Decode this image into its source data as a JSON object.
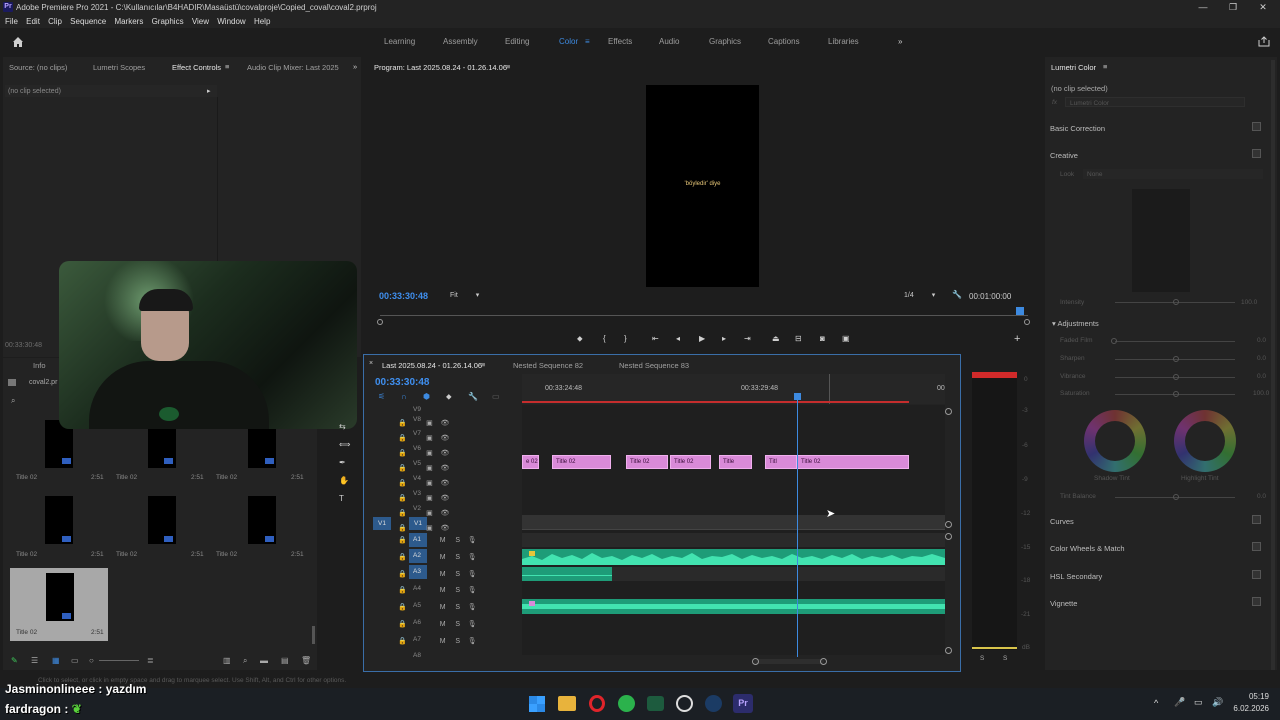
{
  "window": {
    "title": "Adobe Premiere Pro 2021 - C:\\Kullanıcılar\\B4HADIR\\Masaüstü\\covalproje\\Copied_coval\\coval2.prproj",
    "logo": "Pr"
  },
  "menu": [
    "File",
    "Edit",
    "Clip",
    "Sequence",
    "Markers",
    "Graphics",
    "View",
    "Window",
    "Help"
  ],
  "workspaces": [
    "Learning",
    "Assembly",
    "Editing",
    "Color",
    "Effects",
    "Audio",
    "Graphics",
    "Captions",
    "Libraries"
  ],
  "workspace_active": "Color",
  "source_panel": {
    "tabs": [
      "Source: (no clips)",
      "Lumetri Scopes",
      "Effect Controls",
      "Audio Clip Mixer: Last 2025"
    ],
    "active_tab": "Effect Controls",
    "no_clip": "(no clip selected)",
    "timecode": "00:33:30:48"
  },
  "project_panel": {
    "tabs": [
      "Info"
    ],
    "file": "coval2.pr",
    "items": [
      {
        "name": "Title 02",
        "dur": "2:51"
      },
      {
        "name": "Title 02",
        "dur": "2:51"
      },
      {
        "name": "Title 02",
        "dur": "2:51"
      },
      {
        "name": "Title 02",
        "dur": "2:51"
      },
      {
        "name": "Title 02",
        "dur": "2:51"
      },
      {
        "name": "Title 02",
        "dur": "2:51"
      },
      {
        "name": "Title 02",
        "dur": "2:51"
      }
    ]
  },
  "program": {
    "title": "Program: Last 2025.08.24 - 01.26.14.06",
    "caption": "'böyledir' diye",
    "timecode": "00:33:30:48",
    "fit": "Fit",
    "resolution": "1/4",
    "duration": "00:01:00:00"
  },
  "timeline": {
    "tabs": [
      "Last 2025.08.24 - 01.26.14.06",
      "Nested Sequence 82",
      "Nested Sequence 83"
    ],
    "timecode": "00:33:30:48",
    "ruler": [
      "00:33:24:48",
      "00:33:29:48",
      "00"
    ],
    "video_tracks": [
      "V9",
      "V8",
      "V7",
      "V6",
      "V5",
      "V4",
      "V3",
      "V2",
      "V1"
    ],
    "audio_tracks": [
      "A1",
      "A2",
      "A3",
      "A4",
      "A5",
      "A6",
      "A7",
      "A8"
    ],
    "track_buttons": {
      "mute": "M",
      "solo": "S"
    },
    "clips": [
      "e 02",
      "Title 02",
      "Title 02",
      "Title 02",
      "Title",
      "Titl",
      "Title 02"
    ],
    "v1_source": "V1"
  },
  "meter": {
    "scale": [
      "0",
      "-3",
      "-6",
      "-9",
      "-12",
      "-15",
      "-18",
      "-21",
      "dB"
    ],
    "solo": [
      "S",
      "S"
    ]
  },
  "lumetri": {
    "title": "Lumetri Color",
    "no_clip": "(no clip selected)",
    "fx": "fx",
    "effect_name": "Lumetri Color",
    "sections": [
      "Basic Correction",
      "Creative",
      "Curves",
      "Color Wheels & Match",
      "HSL Secondary",
      "Vignette"
    ],
    "look_label": "Look",
    "look_value": "None",
    "intensity": {
      "label": "Intensity",
      "value": "100.0"
    },
    "adjustments_label": "Adjustments",
    "adjust": [
      {
        "label": "Faded Film",
        "value": "0.0"
      },
      {
        "label": "Sharpen",
        "value": "0.0"
      },
      {
        "label": "Vibrance",
        "value": "0.0"
      },
      {
        "label": "Saturation",
        "value": "100.0"
      }
    ],
    "shadow_tint": "Shadow Tint",
    "highlight_tint": "Highlight Tint",
    "tint_balance": {
      "label": "Tint Balance",
      "value": "0.0"
    }
  },
  "status_text": "Click to select, or click in empty space and drag to marquee select. Use Shift, Alt, and Ctrl for other options.",
  "chat": [
    {
      "user": "Jasminonlineee",
      "sep": " : ",
      "msg": "yazdım"
    },
    {
      "user": "fardragon",
      "sep": " : ",
      "msg": ""
    }
  ],
  "taskbar": {
    "time": "05:19",
    "date": "6.02.2026"
  },
  "colors": {
    "accent": "#3d8ae0",
    "clip_pink": "#d98ad8",
    "audio_green": "#2fcf9a",
    "meter_red": "#d12a2a"
  }
}
